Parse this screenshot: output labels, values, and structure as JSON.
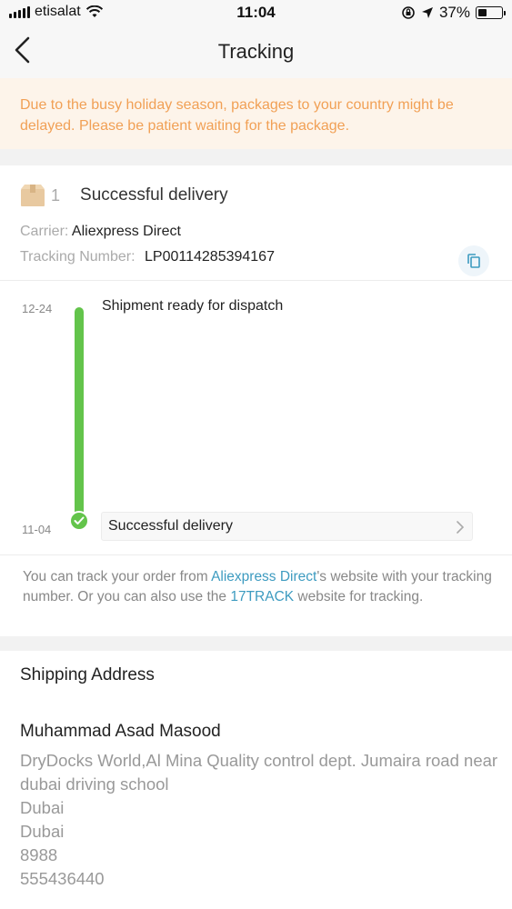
{
  "status_bar": {
    "carrier": "etisalat",
    "time": "11:04",
    "battery": "37%",
    "battery_level": 0.37,
    "icons": [
      "signal-icon",
      "wifi-icon",
      "orientation-lock-icon",
      "location-arrow-icon",
      "battery-icon"
    ]
  },
  "nav": {
    "title": "Tracking",
    "back_icon": "chevron-left-icon"
  },
  "notice": {
    "text": "Due to the busy holiday season, packages to your country might be delayed. Please be patient waiting for the package."
  },
  "package": {
    "count": "1",
    "status": "Successful delivery",
    "carrier_label": "Carrier:",
    "carrier_value": "Aliexpress Direct",
    "tracking_label": "Tracking Number:",
    "tracking_value": "LP00114285394167",
    "copy_icon": "copy-icon"
  },
  "timeline": {
    "events": [
      {
        "date": "12-24",
        "text": "Shipment ready for dispatch"
      },
      {
        "date": "11-04",
        "text": "Successful delivery"
      }
    ]
  },
  "help": {
    "part1": "You can track your order from ",
    "link1": "Aliexpress Direct",
    "part2": "'s website with your tracking number. Or you can also use the ",
    "link2": "17TRACK",
    "part3": " website for tracking."
  },
  "shipping": {
    "title": "Shipping Address",
    "name": "Muhammad Asad Masood",
    "address_lines": [
      "DryDocks World,Al Mina Quality control dept. Jumaira road near dubai driving school",
      "Dubai",
      "Dubai",
      "8988",
      "555436440"
    ]
  },
  "colors": {
    "accent_green": "#63c44b",
    "notice_text": "#f1a055",
    "link_blue": "#3d9bc0"
  }
}
